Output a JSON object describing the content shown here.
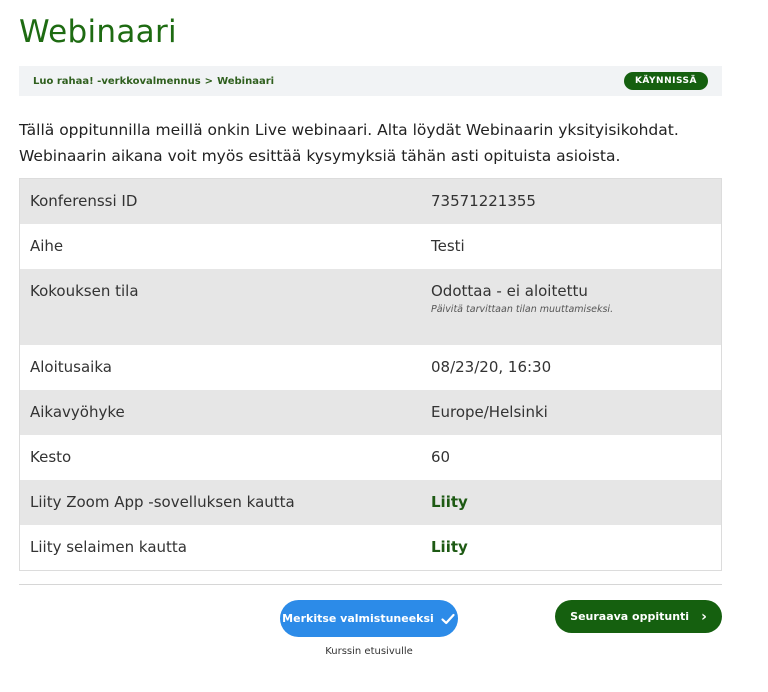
{
  "page": {
    "title": "Webinaari"
  },
  "breadcrumb": {
    "course": "Luo rahaa! -verkkovalmennus",
    "separator": ">",
    "current": "Webinaari",
    "status": "KÄYNNISSÄ"
  },
  "intro": "Tällä oppitunnilla meillä onkin Live webinaari. Alta löydät Webinaarin yksityisikohdat. Webinaarin aikana voit myös esittää kysymyksiä tähän asti opituista asioista.",
  "details": {
    "rows": [
      {
        "label": "Konferenssi ID",
        "value": "73571221355"
      },
      {
        "label": "Aihe",
        "value": "Testi"
      },
      {
        "label": "Kokouksen tila",
        "value": "Odottaa - ei aloitettu",
        "note": "Päivitä tarvittaan tilan muuttamiseksi."
      },
      {
        "label": "Aloitusaika",
        "value": "08/23/20, 16:30"
      },
      {
        "label": "Aikavyöhyke",
        "value": "Europe/Helsinki"
      },
      {
        "label": "Kesto",
        "value": "60"
      },
      {
        "label": "Liity Zoom App -sovelluksen kautta",
        "value": "Liity"
      },
      {
        "label": "Liity selaimen kautta",
        "value": "Liity"
      }
    ]
  },
  "actions": {
    "complete_label": "Merkitse valmistuneeksi",
    "course_home_label": "Kurssin etusivulle",
    "next_label": "Seuraava oppitunti"
  },
  "colors": {
    "title": "#1e6b12",
    "badge": "#15600f",
    "complete_button": "#2c8be8",
    "next_button": "#15600f",
    "row_alt": "#e6e6e6"
  },
  "icons": {
    "complete": "check-icon",
    "next": "chevron-right-icon"
  }
}
